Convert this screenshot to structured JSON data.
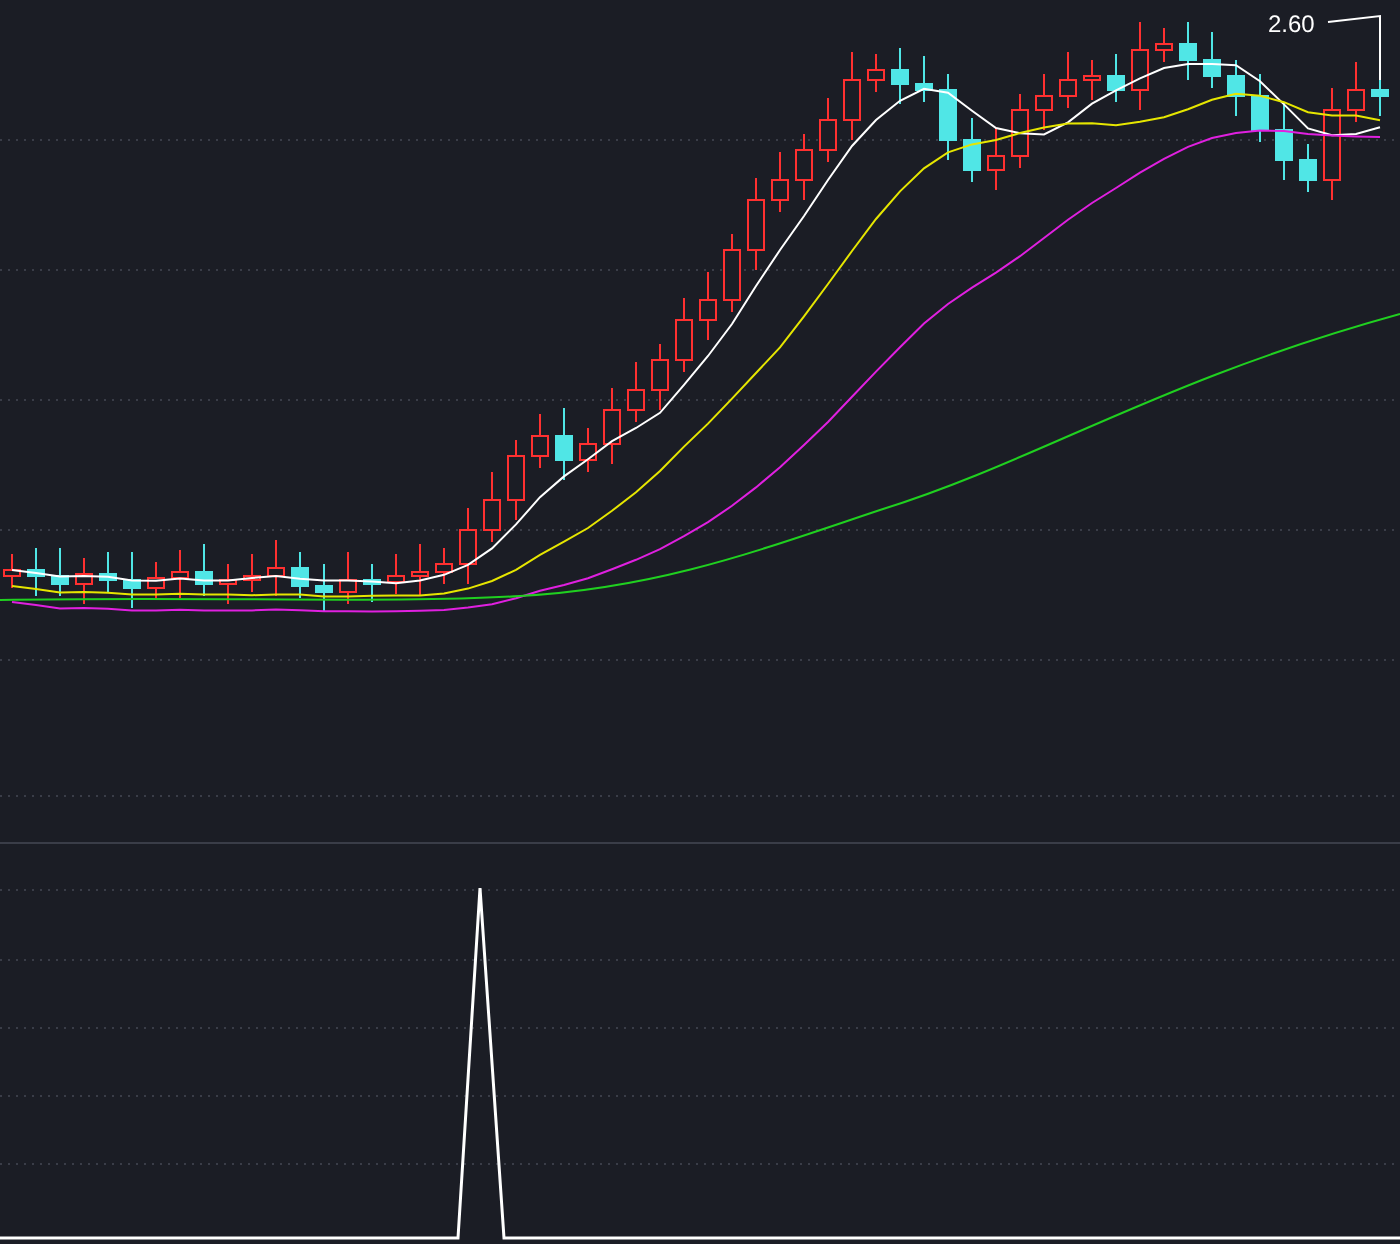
{
  "price_chart": {
    "high_marker": {
      "label": "2.60"
    }
  }
}
